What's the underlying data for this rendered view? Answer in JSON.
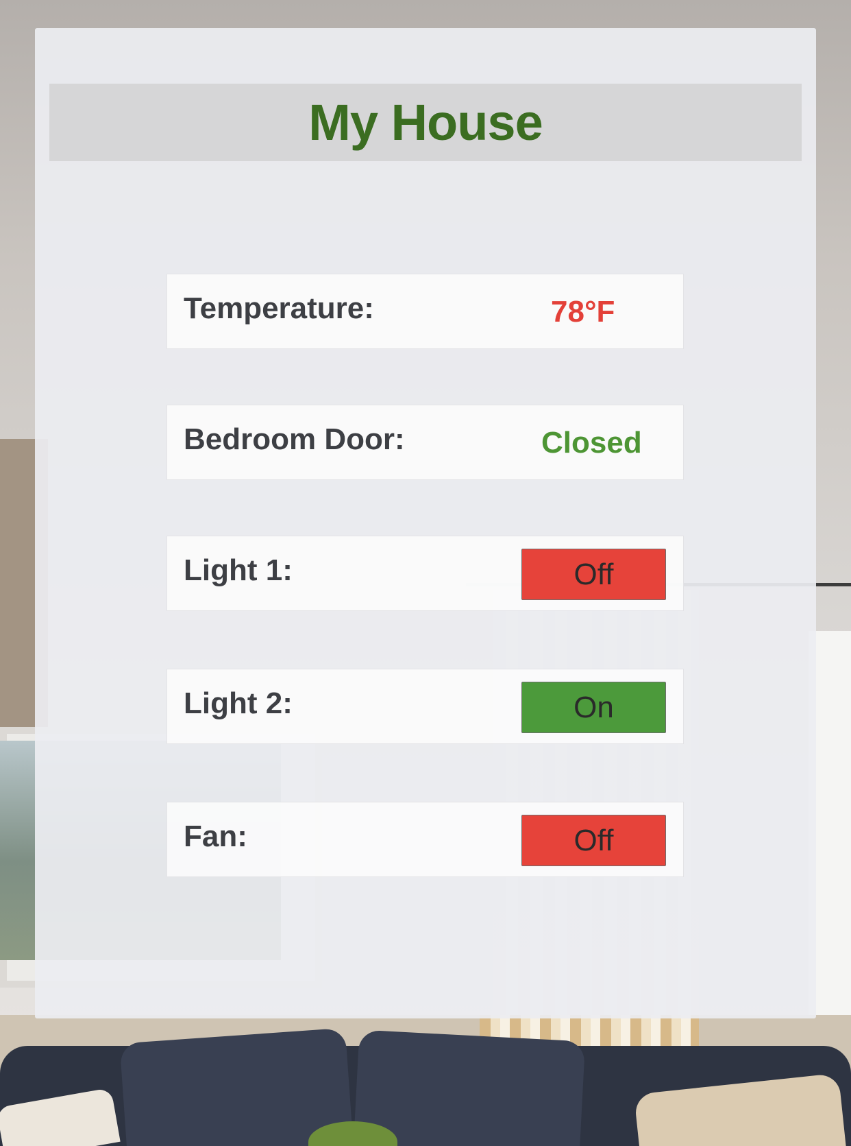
{
  "header": {
    "title": "My House"
  },
  "rows": [
    {
      "label": "Temperature:",
      "value": "78°F",
      "kind": "reading",
      "color": "#e34038"
    },
    {
      "label": "Bedroom Door:",
      "value": "Closed",
      "kind": "reading",
      "color": "#4d9534"
    },
    {
      "label": "Light 1:",
      "value": "Off",
      "kind": "toggle",
      "state": "off",
      "color": "#e6433a"
    },
    {
      "label": "Light 2:",
      "value": "On",
      "kind": "toggle",
      "state": "on",
      "color": "#4c9a3b"
    },
    {
      "label": "Fan:",
      "value": "Off",
      "kind": "toggle",
      "state": "off",
      "color": "#e6433a"
    }
  ],
  "colors": {
    "title": "#3b6d21",
    "on": "#4c9a3b",
    "off": "#e6433a"
  }
}
